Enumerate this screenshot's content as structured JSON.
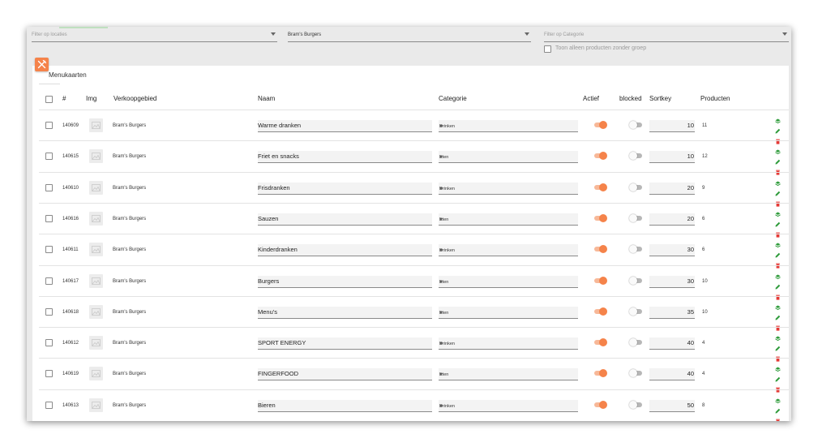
{
  "filters": {
    "locations_placeholder": "Filter op locaties",
    "selected_location": "Bram's Burgers",
    "category_placeholder": "Filter op Categorie",
    "only_without_group_label": "Toon alleen producten zonder groep"
  },
  "card": {
    "title": "Menukaarten"
  },
  "columns": {
    "id": "#",
    "img": "Img",
    "verkoopgebied": "Verkoopgebied",
    "naam": "Naam",
    "categorie": "Categorie",
    "actief": "Actief",
    "blocked": "blocked",
    "sortkey": "Sortkey",
    "producten": "Producten"
  },
  "rows": [
    {
      "id": "140609",
      "area": "Bram's Burgers",
      "name": "Warme dranken",
      "category": "Drinken",
      "actief": true,
      "blocked": false,
      "sortkey": "10",
      "products": "11"
    },
    {
      "id": "140615",
      "area": "Bram's Burgers",
      "name": "Friet en snacks",
      "category": "Eten",
      "actief": true,
      "blocked": false,
      "sortkey": "10",
      "products": "12"
    },
    {
      "id": "140610",
      "area": "Bram's Burgers",
      "name": "Frisdranken",
      "category": "Drinken",
      "actief": true,
      "blocked": false,
      "sortkey": "20",
      "products": "9"
    },
    {
      "id": "140616",
      "area": "Bram's Burgers",
      "name": "Sauzen",
      "category": "Eten",
      "actief": true,
      "blocked": false,
      "sortkey": "20",
      "products": "6"
    },
    {
      "id": "140611",
      "area": "Bram's Burgers",
      "name": "Kinderdranken",
      "category": "Drinken",
      "actief": true,
      "blocked": false,
      "sortkey": "30",
      "products": "6"
    },
    {
      "id": "140617",
      "area": "Bram's Burgers",
      "name": "Burgers",
      "category": "Eten",
      "actief": true,
      "blocked": false,
      "sortkey": "30",
      "products": "10"
    },
    {
      "id": "140618",
      "area": "Bram's Burgers",
      "name": "Menu's",
      "category": "Eten",
      "actief": true,
      "blocked": false,
      "sortkey": "35",
      "products": "10"
    },
    {
      "id": "140612",
      "area": "Bram's Burgers",
      "name": "SPORT ENERGY",
      "category": "Drinken",
      "actief": true,
      "blocked": false,
      "sortkey": "40",
      "products": "4"
    },
    {
      "id": "140619",
      "area": "Bram's Burgers",
      "name": "FINGERFOOD",
      "category": "Eten",
      "actief": true,
      "blocked": false,
      "sortkey": "40",
      "products": "4"
    },
    {
      "id": "140613",
      "area": "Bram's Burgers",
      "name": "Bieren",
      "category": "Drinken",
      "actief": true,
      "blocked": false,
      "sortkey": "50",
      "products": "8"
    }
  ],
  "icons": {
    "card_icon": "cutlery-icon",
    "row_actions": [
      "layers-icon",
      "pencil-icon",
      "trash-icon"
    ]
  },
  "colors": {
    "accent": "#f5834a",
    "toggle_track_on": "#f7b898",
    "layers_icon": "#2e9b3a",
    "edit_icon": "#2e9b3a",
    "delete_icon": "#e53935"
  }
}
